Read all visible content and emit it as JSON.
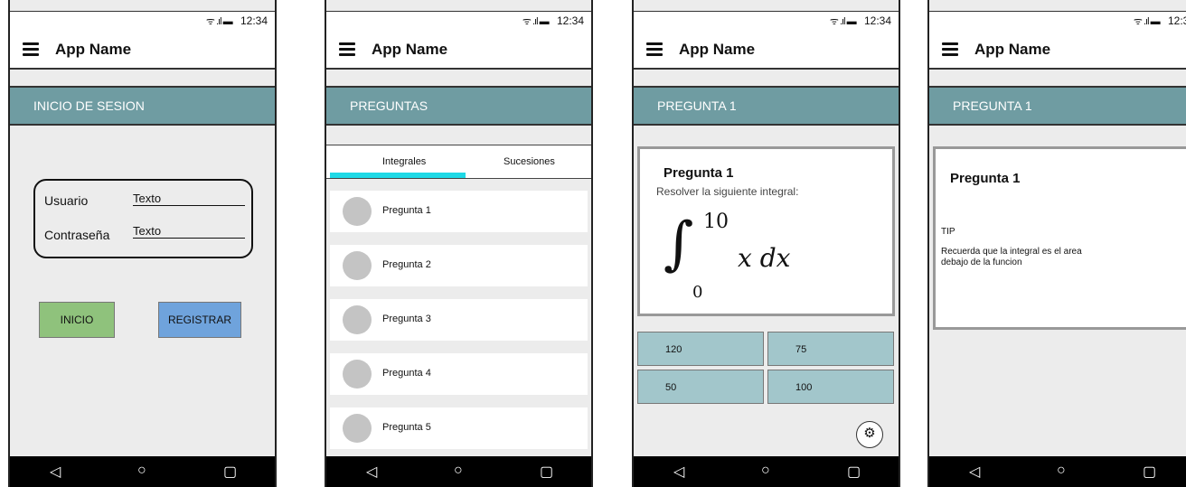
{
  "status": {
    "time": "12:34",
    "signal": "ᯤ .ıl ▬"
  },
  "app_name": "App Name",
  "nav": {
    "back": "◁",
    "home": "○",
    "recent": "▢"
  },
  "screens": {
    "login": {
      "title": "INICIO DE SESION",
      "usuario_label": "Usuario",
      "usuario_value": "Texto",
      "contrasena_label": "Contraseña",
      "contrasena_value": "Texto",
      "inicio_button": "INICIO",
      "registrar_button": "REGISTRAR"
    },
    "preguntas": {
      "title": "PREGUNTAS",
      "tabs": [
        "Integrales",
        "Sucesiones"
      ],
      "items": [
        "Pregunta 1",
        "Pregunta 2",
        "Pregunta 3",
        "Pregunta 4",
        "Pregunta 5"
      ]
    },
    "pregunta": {
      "title": "PREGUNTA 1",
      "card_title": "Pregunta 1",
      "instruction": "Resolver la siguiente integral:",
      "integral_upper": "10",
      "integral_lower": "0",
      "integral_body": "x dx",
      "answers": [
        "120",
        "75",
        "50",
        "100"
      ]
    },
    "tip": {
      "title": "PREGUNTA 1",
      "card_title": "Pregunta 1",
      "tip_label": "TIP",
      "tip_line1": "Recuerda que la integral es el area",
      "tip_line2": "debajo de la funcion"
    }
  },
  "colors": {
    "header": "#6f9ca2",
    "inicio": "#8fc27c",
    "registrar": "#6fa3dc",
    "answer": "#a2c6cb",
    "tab_indicator": "#1ed9e6"
  }
}
